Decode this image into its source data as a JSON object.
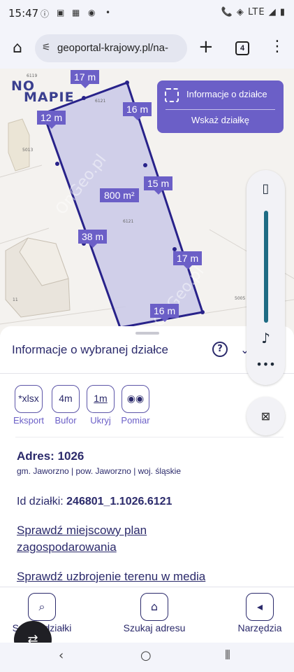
{
  "status_bar": {
    "time": "15:47",
    "right_icons": "📞 ◈ LTE ◢ ▮"
  },
  "browser": {
    "url": "geoportal-krajowy.pl/na-",
    "tab_count": "4"
  },
  "map": {
    "logo_line1": "NO",
    "logo_line2": "MAPIE",
    "dimensions": {
      "top1": "17 m",
      "top_left": "12 m",
      "right1": "16 m",
      "right2": "15 m",
      "left": "38 m",
      "right3": "17 m",
      "bottom": "16 m"
    },
    "area": "800 m²",
    "watermark": "OnGeo.pl",
    "labels": [
      "6119",
      "6121",
      "6121",
      "5013",
      "11",
      "5005"
    ],
    "info_panel": {
      "title": "Informacje o działce",
      "action": "Wskaż działkę"
    }
  },
  "sheet": {
    "title": "Informacje o wybranej działce",
    "tools": [
      {
        "icon": "*xlsx",
        "label": "Eksport"
      },
      {
        "icon": "4m",
        "label": "Bufor"
      },
      {
        "icon": "1m",
        "label": "Ukryj"
      },
      {
        "icon": "◉◉",
        "label": "Pomiar"
      }
    ],
    "address": "Adres: 1026",
    "admin": "gm. Jaworzno | pow. Jaworzno | woj. śląskie",
    "parcel_label": "Id działki:",
    "parcel_id": "246801_1.1026.6121",
    "link1_line1": "Sprawdź miejscowy plan",
    "link1_line2": "zagospodarowania",
    "link2": "Sprawdź uzbrojenie terenu w media"
  },
  "bottom_nav": {
    "item1": "Szukaj działki",
    "item2": "Szukaj adresu",
    "item3": "Narzędzia"
  },
  "colors": {
    "accent": "#6b5fc7",
    "dark_text": "#2b2a6b",
    "parcel_fill": "#c9c9e8"
  }
}
